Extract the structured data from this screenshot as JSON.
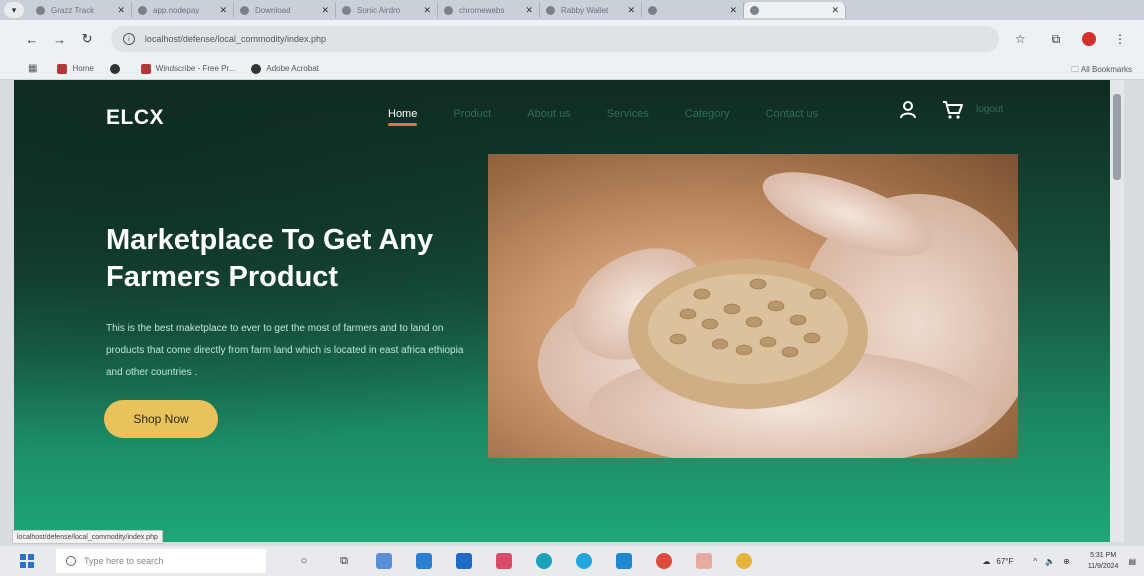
{
  "browser": {
    "tabs": [
      {
        "title": "Grazz Track",
        "active": false
      },
      {
        "title": "app.nodepay",
        "active": false
      },
      {
        "title": "Download",
        "active": false
      },
      {
        "title": "Sonic Airdro",
        "active": false
      },
      {
        "title": "chromewebs",
        "active": false
      },
      {
        "title": "Rabby Wallet",
        "active": false
      },
      {
        "title": "",
        "active": false
      },
      {
        "title": "",
        "active": true
      }
    ],
    "url": "localhost/defense/local_commodity/index.php",
    "bookmarks": [
      {
        "label": "Home",
        "icon": "youtube-icon"
      },
      {
        "label": "",
        "icon": "globe-icon"
      },
      {
        "label": "Windscribe - Free Pr...",
        "icon": "windscribe-icon"
      },
      {
        "label": "Adobe Acrobat",
        "icon": "acrobat-icon"
      }
    ],
    "all_bookmarks": "All Bookmarks"
  },
  "site": {
    "brand": "ELCX",
    "nav": [
      {
        "label": "Home",
        "active": true
      },
      {
        "label": "Product",
        "active": false
      },
      {
        "label": "About us",
        "active": false
      },
      {
        "label": "Services",
        "active": false
      },
      {
        "label": "Category",
        "active": false
      },
      {
        "label": "Contact us",
        "active": false
      }
    ],
    "logout": "logout",
    "hero": {
      "title": "Marketplace To Get Any Farmers Product",
      "description": "This is the best maketplace to ever to get the most of farmers and to land on products that come directly from farm land which is located in east africa ethiopia and other countries .",
      "button": "Shop Now",
      "image_alt": "hands holding coffee beans"
    },
    "colors": {
      "accent": "#e0763e",
      "button": "#e9c25a",
      "background_dark": "#0f2a22",
      "background_light": "#1ea679"
    }
  },
  "status_bar_url": "localhost/defense/local_commodity/index.php",
  "taskbar": {
    "search_placeholder": "Type here to search",
    "temperature": "67°F",
    "time": "5:31 PM",
    "date": "11/9/2024"
  }
}
